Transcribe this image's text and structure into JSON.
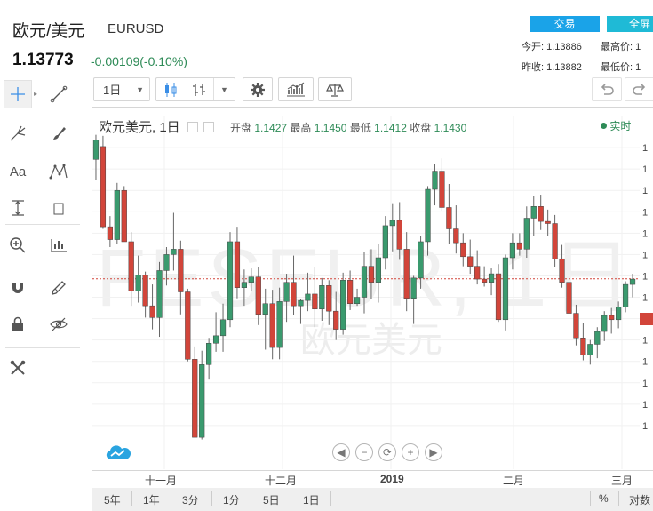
{
  "header": {
    "title": "欧元/美元",
    "symbol": "EURUSD",
    "price": "1.13773",
    "change": "-0.00109(-0.10%)",
    "trade_button": "交易",
    "full_button": "全屏",
    "stats": {
      "open_label": "今开:",
      "open_value": "1.13886",
      "high_label": "最高价:",
      "high_value": "1",
      "prev_close_label": "昨收:",
      "prev_close_value": "1.13882",
      "low_label": "最低价:",
      "low_value": "1"
    }
  },
  "toolbar": {
    "interval": "1日",
    "undo_icon": "undo-icon",
    "redo_icon": "redo-icon"
  },
  "left_tools": {
    "text_tool": "Aa"
  },
  "chart_header": {
    "name": "欧元美元, 1日",
    "open_label": "开盘",
    "open": "1.1427",
    "high_label": "最高",
    "high": "1.1450",
    "low_label": "最低",
    "low": "1.1412",
    "close_label": "收盘",
    "close": "1.1430",
    "realtime": "实时"
  },
  "watermark": {
    "main": "FESEUR, 1日",
    "sub": "欧元美元"
  },
  "colors": {
    "up": "#3a9a6e",
    "down": "#d2453a",
    "price_line": "#d2453a",
    "accent": "#1aa3e8"
  },
  "chart_data": {
    "type": "candlestick",
    "x_labels": [
      "十一月",
      "十二月",
      "2019",
      "二月",
      "三月"
    ],
    "y_labels_visible": "truncated",
    "last_price_marker": "1.13773",
    "series": [
      {
        "ohlc": [
          [
            1.1489,
            1.1512,
            1.147,
            1.1507
          ],
          [
            1.1501,
            1.1511,
            1.1424,
            1.1426
          ],
          [
            1.1426,
            1.1436,
            1.1407,
            1.1414
          ],
          [
            1.1414,
            1.1467,
            1.141,
            1.146
          ],
          [
            1.146,
            1.1464,
            1.1412,
            1.1412
          ],
          [
            1.1412,
            1.1421,
            1.1352,
            1.1366
          ],
          [
            1.1366,
            1.1399,
            1.1355,
            1.1381
          ],
          [
            1.1381,
            1.1384,
            1.1341,
            1.1352
          ],
          [
            1.1352,
            1.1372,
            1.133,
            1.1341
          ],
          [
            1.1341,
            1.1393,
            1.1323,
            1.1385
          ],
          [
            1.1385,
            1.1407,
            1.1371,
            1.14
          ],
          [
            1.14,
            1.1439,
            1.1385,
            1.1405
          ],
          [
            1.1405,
            1.1413,
            1.1344,
            1.1365
          ],
          [
            1.1365,
            1.1368,
            1.13,
            1.1302
          ],
          [
            1.1302,
            1.1314,
            1.1229,
            1.1229
          ],
          [
            1.1229,
            1.131,
            1.1227,
            1.1297
          ],
          [
            1.1297,
            1.1322,
            1.1283,
            1.1317
          ],
          [
            1.1317,
            1.1346,
            1.1309,
            1.1324
          ],
          [
            1.1324,
            1.1354,
            1.1309,
            1.1339
          ],
          [
            1.1339,
            1.1421,
            1.1332,
            1.1412
          ],
          [
            1.1412,
            1.1426,
            1.1359,
            1.1369
          ],
          [
            1.1369,
            1.1386,
            1.1352,
            1.1374
          ],
          [
            1.1374,
            1.1387,
            1.1366,
            1.1379
          ],
          [
            1.1379,
            1.1388,
            1.1334,
            1.1344
          ],
          [
            1.1344,
            1.1368,
            1.1311,
            1.1354
          ],
          [
            1.1354,
            1.1367,
            1.1302,
            1.1313
          ],
          [
            1.1313,
            1.1369,
            1.1302,
            1.1356
          ],
          [
            1.1356,
            1.1382,
            1.1337,
            1.1374
          ],
          [
            1.1374,
            1.1399,
            1.1343,
            1.1352
          ],
          [
            1.1352,
            1.1358,
            1.1335,
            1.1357
          ],
          [
            1.1357,
            1.1383,
            1.1347,
            1.1363
          ],
          [
            1.1363,
            1.1388,
            1.1332,
            1.1349
          ],
          [
            1.1349,
            1.1378,
            1.1338,
            1.1371
          ],
          [
            1.1371,
            1.1376,
            1.1334,
            1.1347
          ],
          [
            1.1347,
            1.1365,
            1.132,
            1.133
          ],
          [
            1.133,
            1.1383,
            1.1325,
            1.1376
          ],
          [
            1.1376,
            1.1385,
            1.1348,
            1.1354
          ],
          [
            1.1354,
            1.1368,
            1.1352,
            1.136
          ],
          [
            1.136,
            1.1402,
            1.1345,
            1.1389
          ],
          [
            1.1389,
            1.1405,
            1.1358,
            1.1374
          ],
          [
            1.1374,
            1.141,
            1.1355,
            1.1397
          ],
          [
            1.1397,
            1.1436,
            1.1386,
            1.1427
          ],
          [
            1.1427,
            1.1448,
            1.1403,
            1.1432
          ],
          [
            1.1432,
            1.1449,
            1.1395,
            1.1405
          ],
          [
            1.1405,
            1.1421,
            1.1347,
            1.1359
          ],
          [
            1.1359,
            1.138,
            1.1335,
            1.1378
          ],
          [
            1.1378,
            1.1417,
            1.1368,
            1.1412
          ],
          [
            1.1412,
            1.1464,
            1.1399,
            1.1461
          ],
          [
            1.1461,
            1.1485,
            1.1446,
            1.1478
          ],
          [
            1.1478,
            1.149,
            1.1441,
            1.1444
          ],
          [
            1.1444,
            1.1466,
            1.141,
            1.1424
          ],
          [
            1.1424,
            1.1446,
            1.1401,
            1.1411
          ],
          [
            1.1411,
            1.142,
            1.1389,
            1.1398
          ],
          [
            1.1398,
            1.1414,
            1.1382,
            1.1389
          ],
          [
            1.1389,
            1.1404,
            1.1372,
            1.1377
          ],
          [
            1.1377,
            1.1389,
            1.137,
            1.1374
          ],
          [
            1.1374,
            1.1387,
            1.1362,
            1.1382
          ],
          [
            1.1382,
            1.1391,
            1.1337,
            1.1339
          ],
          [
            1.1339,
            1.14,
            1.1329,
            1.1397
          ],
          [
            1.1397,
            1.142,
            1.1386,
            1.1411
          ],
          [
            1.1411,
            1.142,
            1.1399,
            1.1405
          ],
          [
            1.1405,
            1.1445,
            1.1397,
            1.1434
          ],
          [
            1.1434,
            1.1455,
            1.1417,
            1.1445
          ],
          [
            1.1445,
            1.1456,
            1.1423,
            1.1431
          ],
          [
            1.1431,
            1.1442,
            1.1417,
            1.1429
          ],
          [
            1.1429,
            1.1437,
            1.1388,
            1.1396
          ],
          [
            1.1396,
            1.1409,
            1.1369,
            1.1374
          ],
          [
            1.1374,
            1.1381,
            1.1339,
            1.1345
          ],
          [
            1.1345,
            1.1353,
            1.1315,
            1.1322
          ],
          [
            1.1322,
            1.1336,
            1.1301,
            1.1306
          ],
          [
            1.1306,
            1.132,
            1.1297,
            1.1316
          ],
          [
            1.1316,
            1.1332,
            1.1303,
            1.1328
          ],
          [
            1.1328,
            1.1347,
            1.1319,
            1.1343
          ],
          [
            1.1343,
            1.135,
            1.1326,
            1.1339
          ],
          [
            1.1339,
            1.1356,
            1.1331,
            1.1351
          ],
          [
            1.1351,
            1.1375,
            1.1346,
            1.1372
          ],
          [
            1.1372,
            1.1382,
            1.136,
            1.1377
          ]
        ]
      }
    ]
  },
  "nav_buttons": [
    "◀",
    "−",
    "⟳",
    "+",
    "▶"
  ],
  "bottom_bar": {
    "ranges": [
      "5年",
      "1年",
      "3分",
      "1分",
      "5日",
      "1日"
    ],
    "percent": "%",
    "log": "对数"
  }
}
